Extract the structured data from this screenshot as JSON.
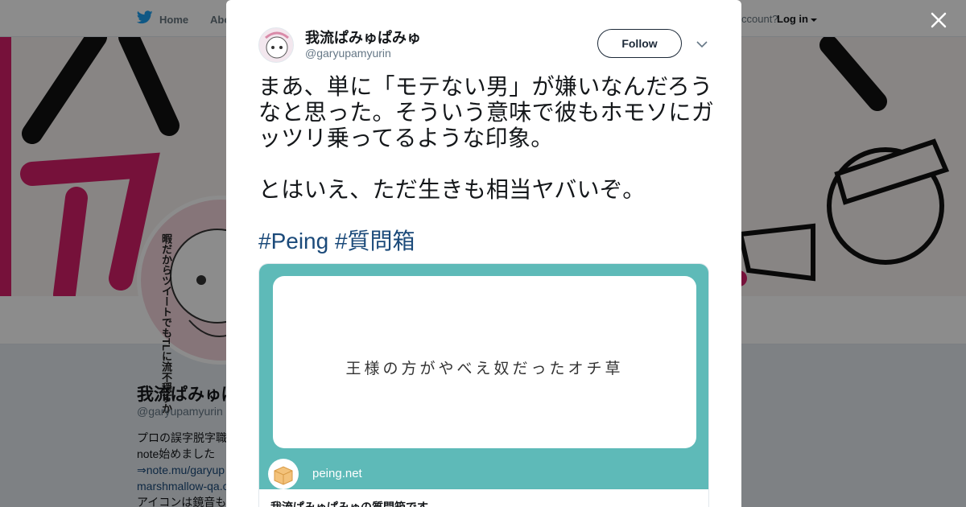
{
  "nav": {
    "home_label": "Home",
    "about_label": "Abo",
    "account_prompt": "ccount?",
    "login_label": "Log in"
  },
  "profile": {
    "name": "我流ぱみゅぱみゅ",
    "handle": "@garyupamyurin",
    "avatar_caption": "暇だからツイートでもTLに流不穏すか",
    "bio_lines": [
      "プロの誤字脱字職",
      "note始めました"
    ],
    "bio_link_1": "⇒note.mu/garyup",
    "bio_link_2": "marshmallow-qa.c",
    "bio_line_3": "アイコンは鏡音も"
  },
  "tweet": {
    "author_name": "我流ぱみゅぱみゅ",
    "author_handle": "@garyupamyurin",
    "follow_label": "Follow",
    "text": "まあ、単に「モテない男」が嫌いなんだろうなと思った。そういう意味で彼もホモソにガッツリ乗ってるような印象。\n\nとはいえ、ただ生きも相当ヤバいぞ。",
    "hashtags": [
      "#Peing",
      "#質問箱"
    ],
    "card": {
      "image_text": "王様の方がやべえ奴だったオチ草",
      "domain": "peing.net",
      "title": "我流ぱみゅぱみゅの質問箱です"
    }
  },
  "colors": {
    "link": "#1b4a7a",
    "card_teal": "#5ebab8",
    "banner_pink": "#d81f6b",
    "twitter_blue": "#1da1f2"
  },
  "icons": {
    "close": "close-icon",
    "chevron": "chevron-down-icon",
    "bird": "twitter-bird-icon"
  }
}
